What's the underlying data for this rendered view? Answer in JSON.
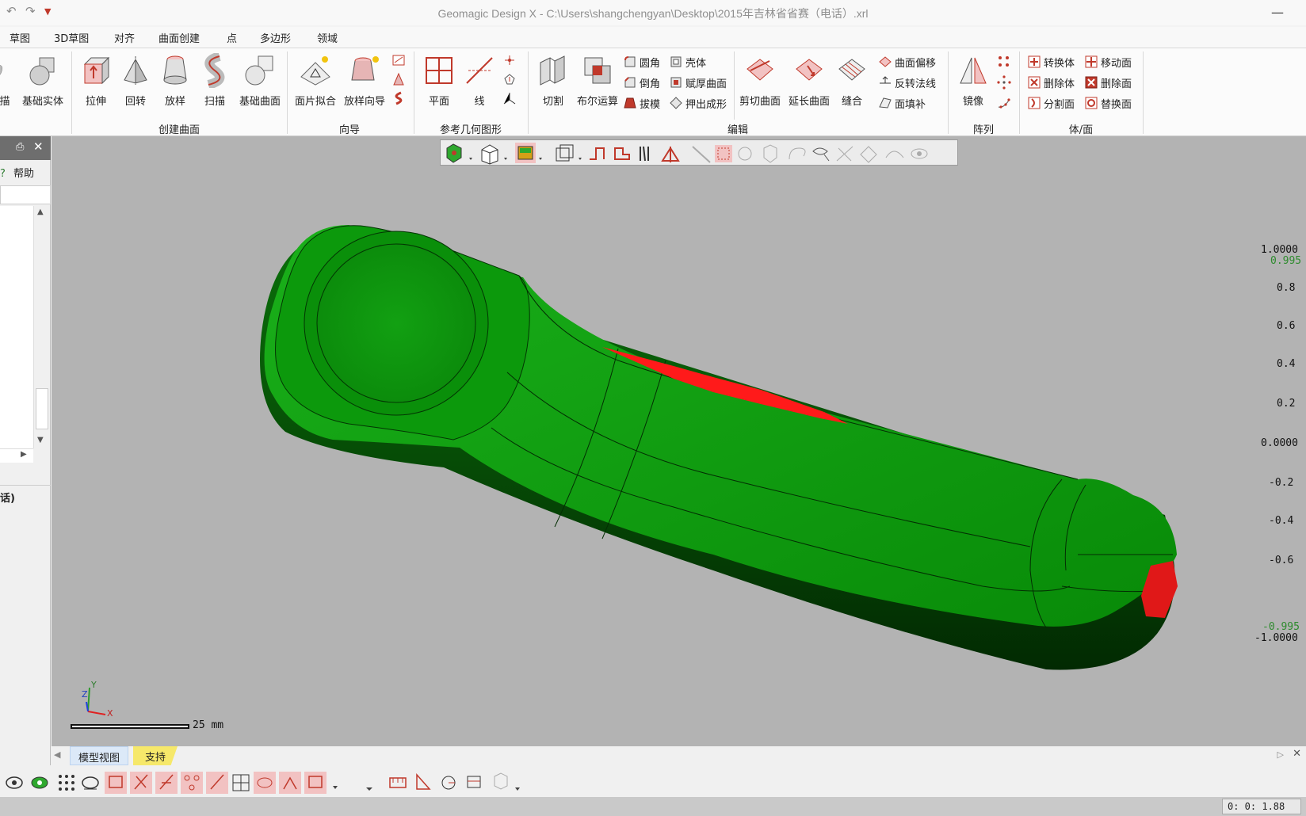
{
  "window": {
    "title": "Geomagic Design X - C:\\Users\\shangchengyan\\Desktop\\2015年吉林省省赛（电话）.xrl"
  },
  "menu": {
    "items": [
      "草图",
      "3D草图",
      "对齐",
      "曲面创建",
      "点",
      "多边形",
      "领域"
    ]
  },
  "ribbon": {
    "create": {
      "scan_label": "描",
      "basic_solid": "基础实体",
      "extrude": "拉伸",
      "revolve": "回转",
      "loft": "放样",
      "sweep": "扫描",
      "basic_surface": "基础曲面",
      "group": "创建曲面"
    },
    "wizard": {
      "patch_fit": "面片拟合",
      "loft_wizard": "放样向导",
      "group": "向导"
    },
    "refgeo": {
      "plane": "平面",
      "line": "线",
      "group": "参考几何图形"
    },
    "edit": {
      "cut": "切割",
      "boolean": "布尔运算",
      "fillet": "圆角",
      "chamfer": "倒角",
      "draft": "拔模",
      "shell": "壳体",
      "thicken": "赋厚曲面",
      "extrude_form": "押出成形",
      "trim": "剪切曲面",
      "extend": "延长曲面",
      "sew": "缝合",
      "offset": "曲面偏移",
      "reverse_normal": "反转法线",
      "fill_face": "面填补",
      "group": "编辑"
    },
    "pattern": {
      "mirror": "镜像",
      "group": "阵列"
    },
    "bodyface": {
      "convert": "转换体",
      "delete_body": "删除体",
      "split_face": "分割面",
      "move_face": "移动面",
      "delete_face": "删除面",
      "replace_face": "替换面",
      "group": "体/面"
    }
  },
  "left_panel": {
    "help": "帮助",
    "tree_item": "话)"
  },
  "scale": {
    "ticks": [
      "1.0000",
      "0.995",
      "0.8",
      "0.6",
      "0.4",
      "0.2",
      "0.0000",
      "-0.2",
      "-0.4",
      "-0.6",
      "-0.995",
      "-1.0000"
    ],
    "bar_label": "25 mm"
  },
  "axes": {
    "x": "X",
    "y": "Y",
    "z": "Z"
  },
  "tabs": {
    "model_view": "模型视图",
    "support": "支持"
  },
  "status": {
    "coord": "0: 0: 1.88"
  },
  "colors": {
    "model_green": "#0a9b0a",
    "deviation_red": "#ff1a1a",
    "viewport_bg": "#b3b3b3"
  }
}
